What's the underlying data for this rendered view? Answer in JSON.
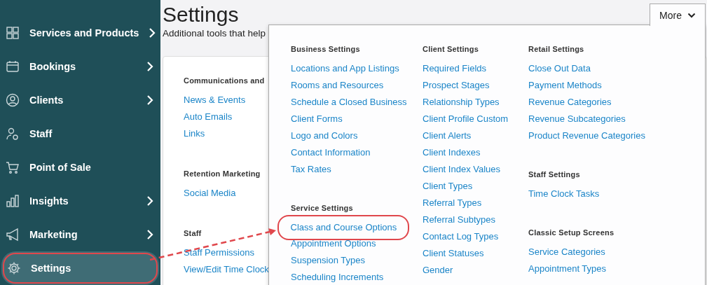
{
  "sidebar": {
    "items": [
      {
        "label": "Services and Products",
        "has_submenu": true,
        "selected": false,
        "annotated": false
      },
      {
        "label": "Bookings",
        "has_submenu": true,
        "selected": false,
        "annotated": false
      },
      {
        "label": "Clients",
        "has_submenu": true,
        "selected": false,
        "annotated": false
      },
      {
        "label": "Staff",
        "has_submenu": false,
        "selected": false,
        "annotated": false
      },
      {
        "label": "Point of Sale",
        "has_submenu": false,
        "selected": false,
        "annotated": false
      },
      {
        "label": "Insights",
        "has_submenu": true,
        "selected": false,
        "annotated": false
      },
      {
        "label": "Marketing",
        "has_submenu": true,
        "selected": false,
        "annotated": false
      },
      {
        "label": "Settings",
        "has_submenu": false,
        "selected": true,
        "annotated": true
      }
    ]
  },
  "page": {
    "title": "Settings",
    "subtitle": "Additional tools that help"
  },
  "card": {
    "sections": [
      {
        "heading": "Communications and",
        "links": [
          "News & Events",
          "Auto Emails",
          "Links"
        ]
      },
      {
        "heading": "Retention Marketing",
        "links": [
          "Social Media"
        ]
      },
      {
        "heading": "Staff",
        "links": [
          "Staff Permissions",
          "View/Edit Time Clock"
        ]
      }
    ]
  },
  "more_button": {
    "label": "More",
    "expanded": true
  },
  "dropdown": {
    "columns": [
      {
        "sections": [
          {
            "heading": "Business Settings",
            "links": [
              {
                "label": "Locations and App Listings",
                "annotated": false
              },
              {
                "label": "Rooms and Resources",
                "annotated": false
              },
              {
                "label": "Schedule a Closed Business",
                "annotated": false
              },
              {
                "label": "Client Forms",
                "annotated": false
              },
              {
                "label": "Logo and Colors",
                "annotated": false
              },
              {
                "label": "Contact Information",
                "annotated": false
              },
              {
                "label": "Tax Rates",
                "annotated": false
              }
            ]
          },
          {
            "heading": "Service Settings",
            "links": [
              {
                "label": "Class and Course Options",
                "annotated": true
              },
              {
                "label": "Appointment Options",
                "annotated": false
              },
              {
                "label": "Suspension Types",
                "annotated": false
              },
              {
                "label": "Scheduling Increments",
                "annotated": false
              }
            ]
          }
        ]
      },
      {
        "sections": [
          {
            "heading": "Client Settings",
            "links": [
              {
                "label": "Required Fields",
                "annotated": false
              },
              {
                "label": "Prospect Stages",
                "annotated": false
              },
              {
                "label": "Relationship Types",
                "annotated": false
              },
              {
                "label": "Client Profile Custom",
                "annotated": false
              },
              {
                "label": "Client Alerts",
                "annotated": false
              },
              {
                "label": "Client Indexes",
                "annotated": false
              },
              {
                "label": "Client Index Values",
                "annotated": false
              },
              {
                "label": "Client Types",
                "annotated": false
              },
              {
                "label": "Referral Types",
                "annotated": false
              },
              {
                "label": "Referral Subtypes",
                "annotated": false
              },
              {
                "label": "Contact Log Types",
                "annotated": false
              },
              {
                "label": "Client Statuses",
                "annotated": false
              },
              {
                "label": "Gender",
                "annotated": false
              }
            ]
          }
        ]
      },
      {
        "sections": [
          {
            "heading": "Retail Settings",
            "links": [
              {
                "label": "Close Out Data",
                "annotated": false
              },
              {
                "label": "Payment Methods",
                "annotated": false
              },
              {
                "label": "Revenue Categories",
                "annotated": false
              },
              {
                "label": "Revenue Subcategories",
                "annotated": false
              },
              {
                "label": "Product Revenue Categories",
                "annotated": false
              }
            ]
          },
          {
            "heading": "Staff Settings",
            "links": [
              {
                "label": "Time Clock Tasks",
                "annotated": false
              }
            ]
          },
          {
            "heading": "Classic Setup Screens",
            "links": [
              {
                "label": "Service Categories",
                "annotated": false
              },
              {
                "label": "Appointment Types",
                "annotated": false
              }
            ]
          }
        ]
      }
    ]
  }
}
